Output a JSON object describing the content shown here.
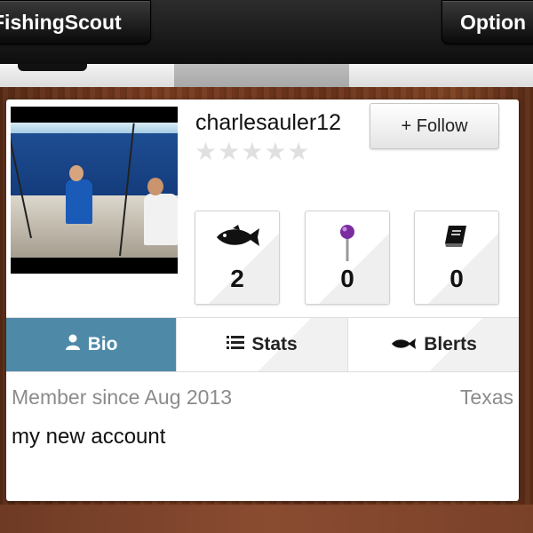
{
  "nav": {
    "left_label": "FishingScout",
    "right_label": "Option"
  },
  "profile": {
    "username": "charlesauler12",
    "rating_stars": 0,
    "rating_max": 5,
    "follow_label": "+ Follow",
    "stats": [
      {
        "icon": "fish-icon",
        "value": "2"
      },
      {
        "icon": "map-pin-icon",
        "value": "0"
      },
      {
        "icon": "book-icon",
        "value": "0"
      }
    ],
    "tabs": [
      {
        "label": "Bio",
        "icon": "user-icon",
        "active": true
      },
      {
        "label": "Stats",
        "icon": "list-icon",
        "active": false
      },
      {
        "label": "Blerts",
        "icon": "fish-icon",
        "active": false
      }
    ],
    "member_since": "Member since Aug 2013",
    "location": "Texas",
    "bio": "my new account"
  },
  "colors": {
    "active_tab": "#4e8aa7",
    "pin_head": "#7b2da0"
  }
}
